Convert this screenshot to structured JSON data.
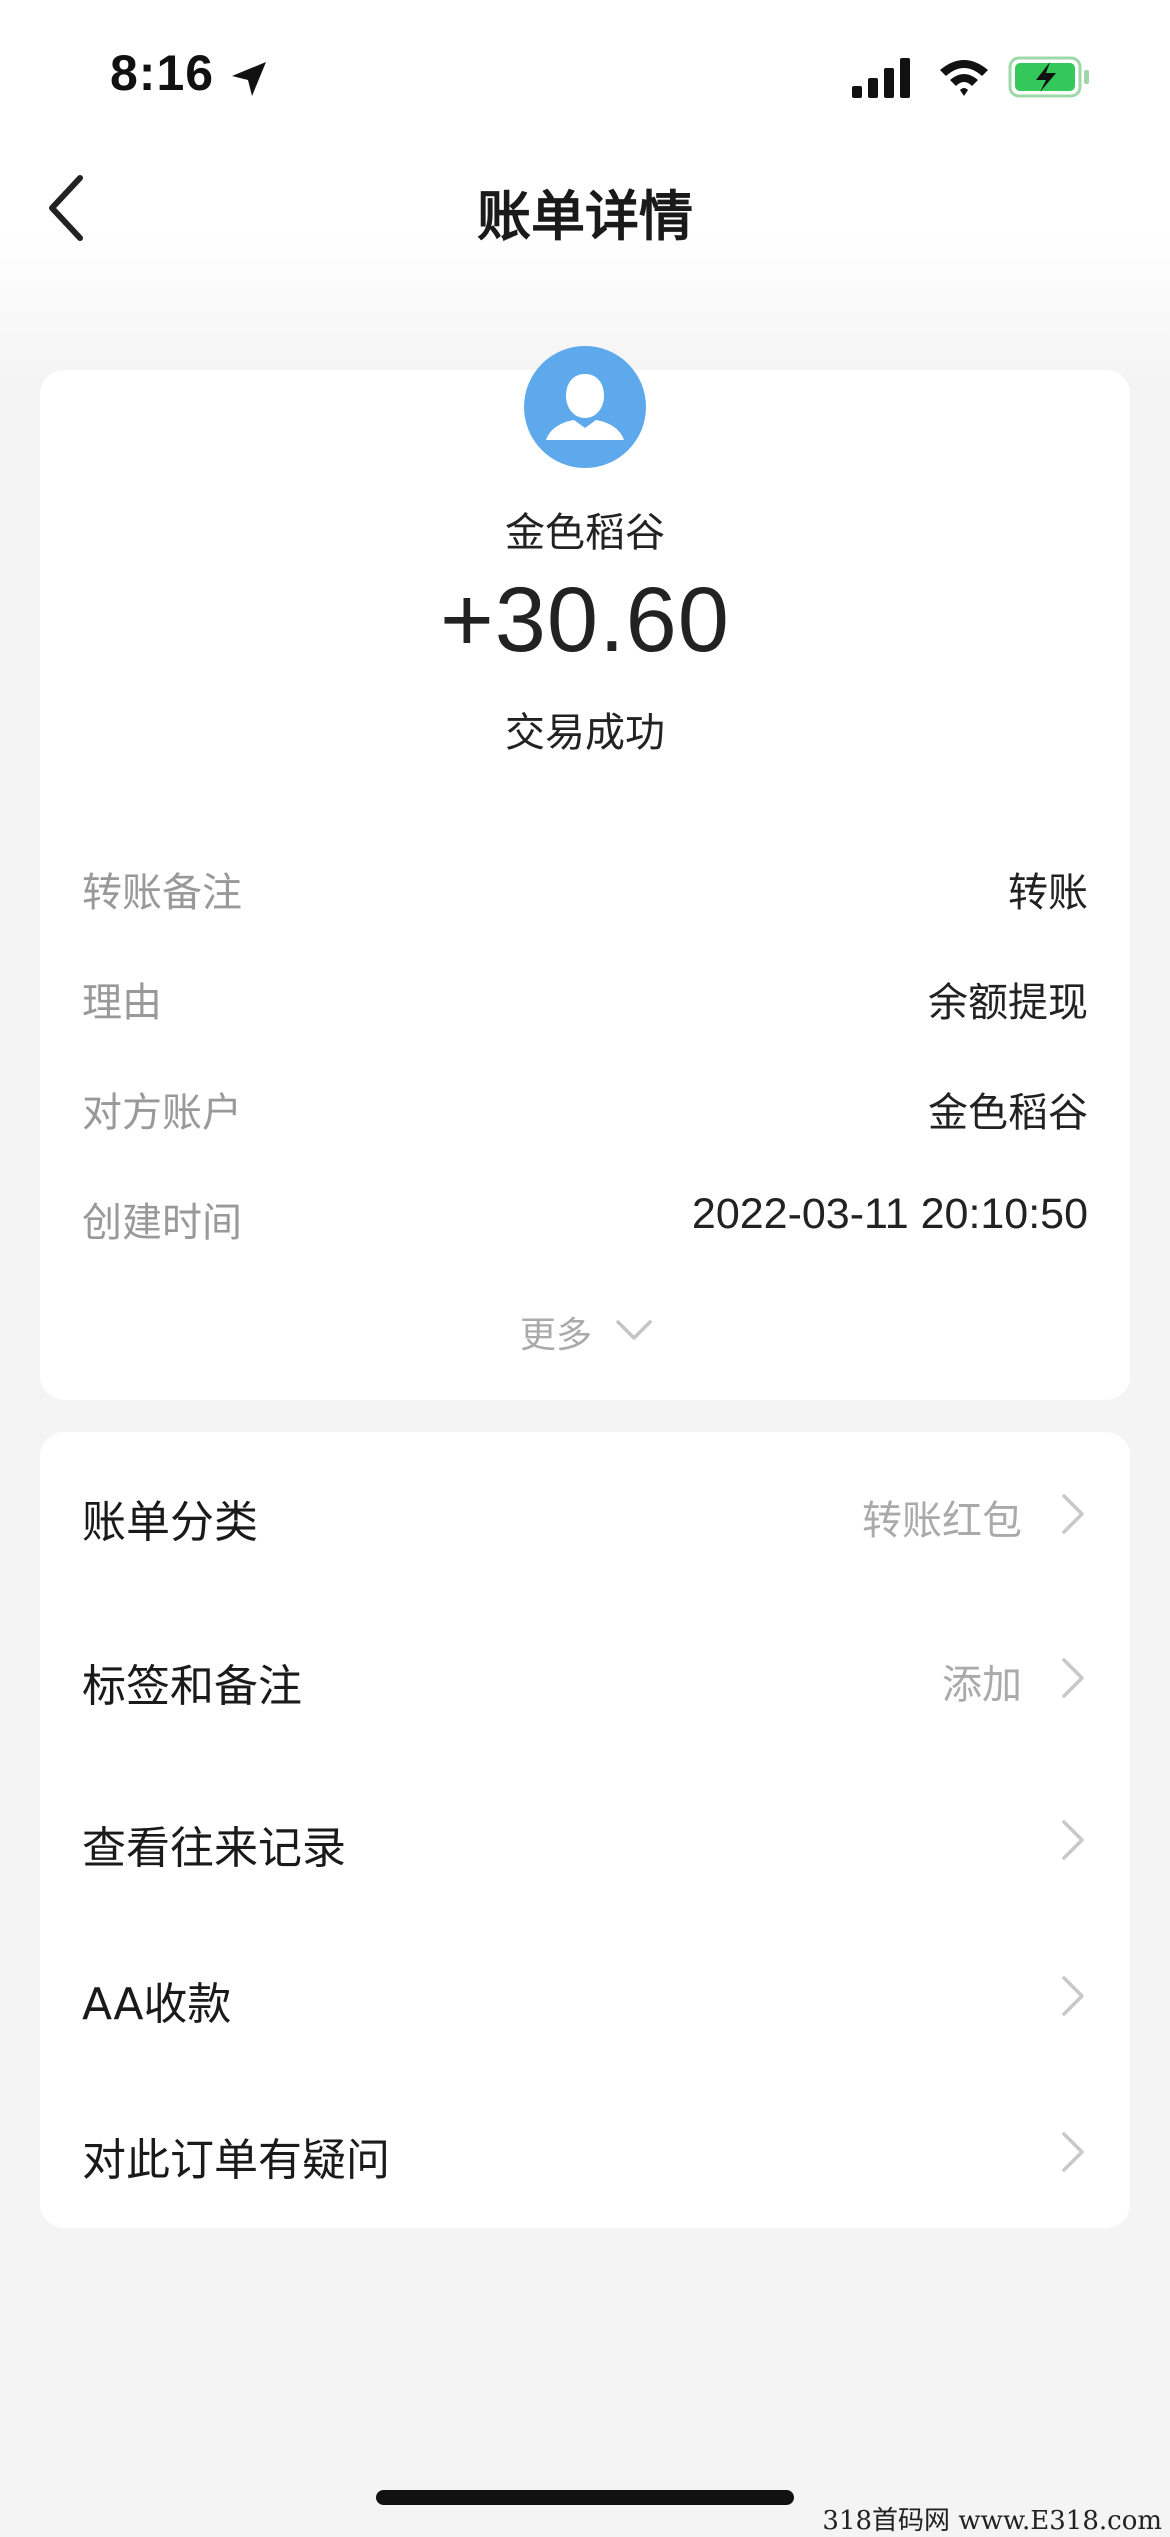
{
  "status_bar": {
    "time": "8:16",
    "location_icon": "location-arrow-icon",
    "signal_icon": "cellular-signal-icon",
    "wifi_icon": "wifi-icon",
    "battery_icon": "battery-charging-icon"
  },
  "nav": {
    "back_icon": "chevron-left-icon",
    "title": "账单详情"
  },
  "summary": {
    "avatar_icon": "user-avatar-icon",
    "counterparty": "金色稻谷",
    "amount": "+30.60",
    "status": "交易成功"
  },
  "details": [
    {
      "label": "转账备注",
      "value": "转账"
    },
    {
      "label": "理由",
      "value": "余额提现"
    },
    {
      "label": "对方账户",
      "value": "金色稻谷"
    },
    {
      "label": "创建时间",
      "value": "2022-03-11 20:10:50"
    }
  ],
  "more": {
    "label": "更多"
  },
  "menu": [
    {
      "label": "账单分类",
      "value": "转账红包"
    },
    {
      "label": "标签和备注",
      "value": "添加"
    },
    {
      "label": "查看往来记录",
      "value": ""
    },
    {
      "label": "AA收款",
      "value": ""
    },
    {
      "label": "对此订单有疑问",
      "value": ""
    }
  ],
  "watermark": "318首码网 www.E318.com",
  "colors": {
    "background": "#f4f4f4",
    "card": "#ffffff",
    "avatar": "#5ea9ec",
    "battery": "#34c759",
    "muted_text": "#999999"
  }
}
